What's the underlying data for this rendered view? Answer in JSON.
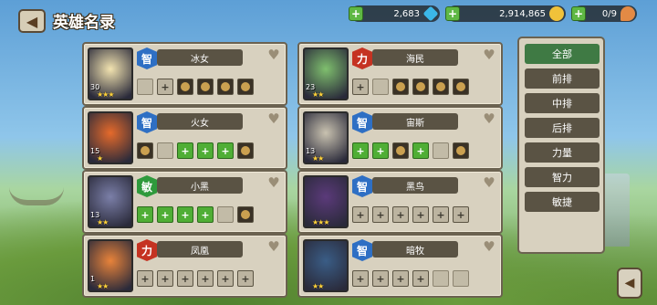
{
  "header": {
    "title": "英雄名录",
    "back_icon": "back-arrow-icon"
  },
  "resources": [
    {
      "value": "2,683",
      "icon": "gem-icon"
    },
    {
      "value": "2,914,865",
      "icon": "gold-icon"
    },
    {
      "value": "0/9",
      "icon": "meat-icon"
    }
  ],
  "heroes": [
    {
      "name": "冰女",
      "attr": "智",
      "attr_type": "int",
      "level": "30",
      "stars": "★★★",
      "portrait_color": "#f2e3b0",
      "equips": [
        "empty",
        "plus",
        "gear",
        "gear",
        "gear",
        "gear"
      ]
    },
    {
      "name": "海民",
      "attr": "力",
      "attr_type": "str",
      "level": "23",
      "stars": "★★",
      "portrait_color": "#7fbf6e",
      "equips": [
        "plus",
        "empty",
        "gear",
        "gear",
        "gear",
        "gear"
      ]
    },
    {
      "name": "火女",
      "attr": "智",
      "attr_type": "int",
      "level": "15",
      "stars": "★",
      "portrait_color": "#e56a2b",
      "equips": [
        "gear",
        "empty",
        "plus-green",
        "plus-green",
        "plus-green",
        "gear"
      ]
    },
    {
      "name": "宙斯",
      "attr": "智",
      "attr_type": "int",
      "level": "13",
      "stars": "★★",
      "portrait_color": "#c9c2b0",
      "equips": [
        "plus-green",
        "plus-green",
        "gear",
        "plus-green",
        "empty",
        "gear"
      ]
    },
    {
      "name": "小黑",
      "attr": "敏",
      "attr_type": "agi",
      "level": "13",
      "stars": "★★",
      "portrait_color": "#7b7fa8",
      "equips": [
        "plus-green",
        "plus-green",
        "plus-green",
        "plus-green",
        "empty",
        "gear"
      ]
    },
    {
      "name": "黑鸟",
      "attr": "智",
      "attr_type": "int",
      "level": "",
      "stars": "★★★",
      "portrait_color": "#5b3a7a",
      "equips": [
        "plus",
        "plus",
        "plus",
        "plus",
        "plus",
        "plus"
      ]
    },
    {
      "name": "凤凰",
      "attr": "力",
      "attr_type": "str",
      "level": "1",
      "stars": "★★",
      "portrait_color": "#e8833a",
      "equips": [
        "plus",
        "plus",
        "plus",
        "plus",
        "plus",
        "plus"
      ]
    },
    {
      "name": "暗牧",
      "attr": "智",
      "attr_type": "int",
      "level": "",
      "stars": "★★",
      "portrait_color": "#3a5d86",
      "equips": [
        "plus",
        "plus",
        "plus",
        "plus",
        "empty",
        "empty"
      ]
    }
  ],
  "filters": [
    "全部",
    "前排",
    "中排",
    "后排",
    "力量",
    "智力",
    "敏捷"
  ],
  "active_filter": "全部"
}
